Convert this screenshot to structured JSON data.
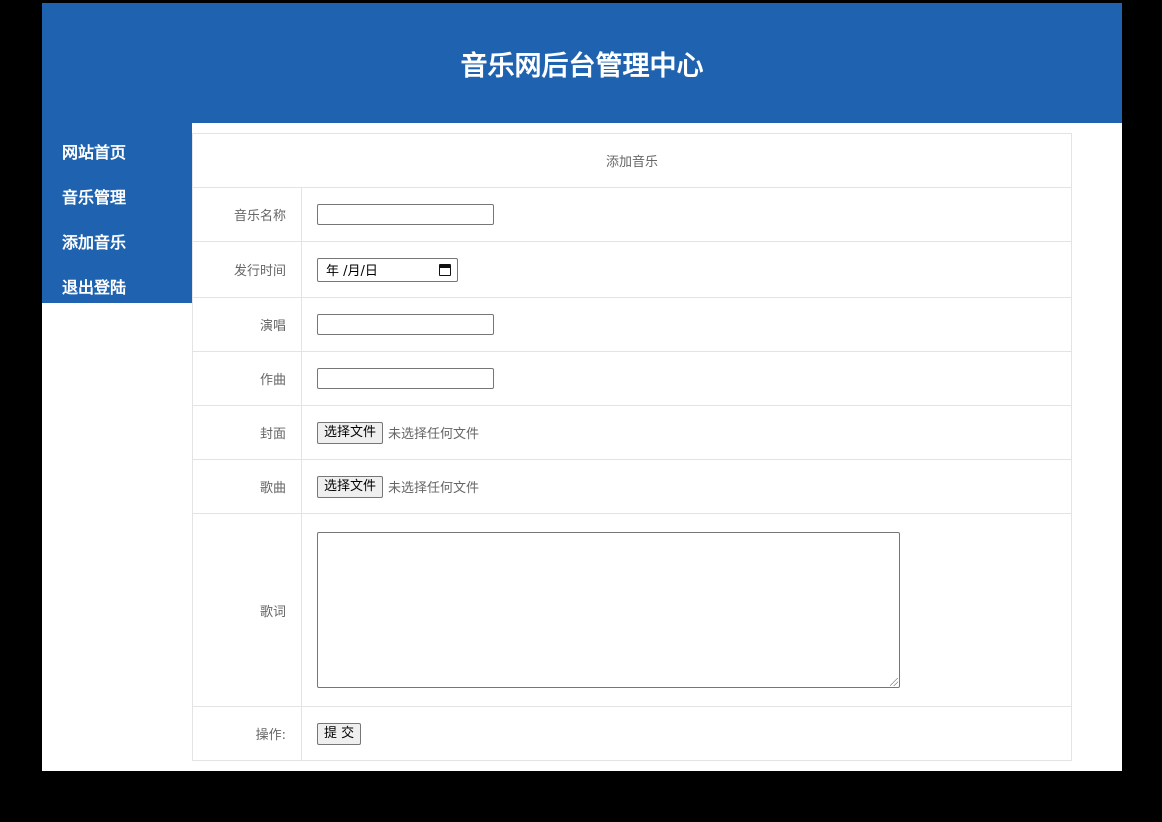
{
  "header": {
    "title": "音乐网后台管理中心"
  },
  "sidebar": {
    "items": [
      {
        "label": "网站首页"
      },
      {
        "label": "音乐管理"
      },
      {
        "label": "添加音乐"
      },
      {
        "label": "退出登陆"
      }
    ]
  },
  "form": {
    "title": "添加音乐",
    "fields": {
      "name": {
        "label": "音乐名称",
        "value": ""
      },
      "release_date": {
        "label": "发行时间",
        "value": "",
        "display": "年 /月/日",
        "icon": "calendar-icon"
      },
      "singer": {
        "label": "演唱",
        "value": ""
      },
      "composer": {
        "label": "作曲",
        "value": ""
      },
      "cover": {
        "label": "封面",
        "button": "选择文件",
        "status": "未选择任何文件"
      },
      "song": {
        "label": "歌曲",
        "button": "选择文件",
        "status": "未选择任何文件"
      },
      "lyrics": {
        "label": "歌词",
        "value": ""
      },
      "actions": {
        "label": "操作:",
        "submit": "提 交"
      }
    }
  },
  "colors": {
    "header_bg": "#1f63b0",
    "sidebar_bg": "#1f63b0",
    "page_bg": "#000000",
    "panel_bg": "#ffffff",
    "border": "#e3e3e3"
  }
}
